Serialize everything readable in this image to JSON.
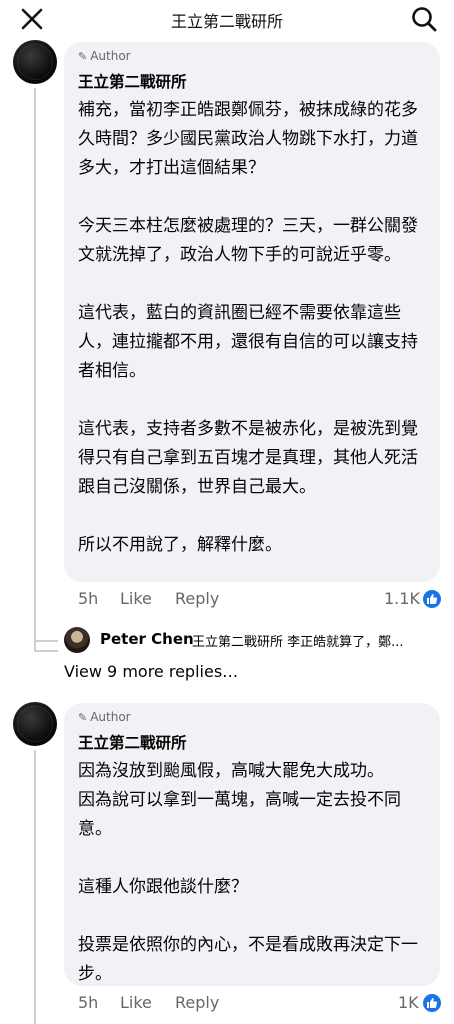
{
  "header": {
    "title": "王立第二戰研所",
    "close_icon": "close-icon",
    "search_icon": "search-icon"
  },
  "comments": [
    {
      "badge": "Author",
      "name": "王立第二戰研所",
      "text": "補充，當初李正皓跟鄭佩芬，被抹成綠的花多久時間？多少國民黨政治人物跳下水打，力道多大，才打出這個結果？\n\n今天三本柱怎麼被處理的？三天，一群公關發文就洗掉了，政治人物下手的可說近乎零。\n\n這代表，藍白的資訊圈已經不需要依靠這些人，連拉攏都不用，還很有自信的可以讓支持者相信。\n\n這代表，支持者多數不是被赤化，是被洗到覺得只有自己拿到五百塊才是真理，其他人死活跟自己沒關係，世界自己最大。\n\n所以不用說了，解釋什麼。",
      "time": "5h",
      "like_label": "Like",
      "reply_label": "Reply",
      "reactions": "1.1K"
    },
    {
      "badge": "Author",
      "name": "王立第二戰研所",
      "text": "因為沒放到颱風假，高喊大罷免大成功。\n因為說可以拿到一萬塊，高喊一定去投不同意。\n\n這種人你跟他談什麼？\n\n投票是依照你的內心，不是看成敗再決定下一步。",
      "time": "5h",
      "like_label": "Like",
      "reply_label": "Reply",
      "reactions": "1K"
    }
  ],
  "reply_preview": {
    "name": "Peter Chen",
    "text": "王立第二戰研所 李正皓就算了，鄭..."
  },
  "view_more": "View 9 more replies…",
  "colors": {
    "bubble": "#f0f2f5",
    "secondary_text": "#65676b",
    "like_blue": "#1b74e4",
    "thread_line": "#ced0d4"
  }
}
